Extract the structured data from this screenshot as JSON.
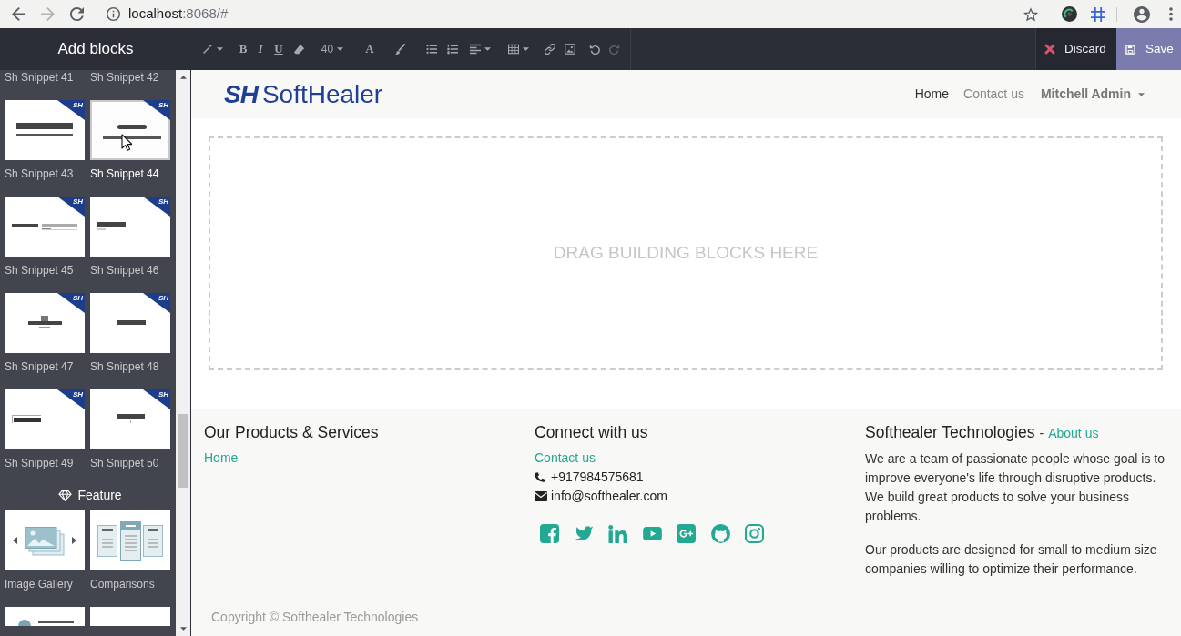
{
  "browser": {
    "nav_buttons": [
      {
        "kind": "back",
        "disabled": false
      },
      {
        "kind": "forward",
        "disabled": true
      },
      {
        "kind": "reload",
        "disabled": false
      }
    ],
    "url": {
      "host": "localhost",
      "path": ":8068/#"
    },
    "bookmarked": false
  },
  "editor_bar": {
    "sidebar_title": "Add blocks",
    "tools": [
      {
        "kind": "wand",
        "dropdown": true,
        "disabled": false
      },
      {
        "kind": "bold",
        "label": "B",
        "dropdown": false,
        "disabled": false
      },
      {
        "kind": "italic",
        "label": "I",
        "dropdown": false,
        "disabled": false
      },
      {
        "kind": "underline",
        "label": "U",
        "dropdown": false,
        "disabled": false
      },
      {
        "kind": "eraser",
        "dropdown": false,
        "disabled": false
      },
      {
        "kind": "fontsize",
        "label": "40",
        "dropdown": true,
        "disabled": false
      },
      {
        "kind": "fontcolor",
        "label": "A",
        "dropdown": false,
        "disabled": false
      },
      {
        "kind": "brush",
        "dropdown": false,
        "disabled": false
      },
      {
        "kind": "bullets",
        "dropdown": false,
        "disabled": false
      },
      {
        "kind": "numbers",
        "dropdown": false,
        "disabled": false
      },
      {
        "kind": "align",
        "dropdown": true,
        "disabled": false
      },
      {
        "kind": "table",
        "dropdown": true,
        "disabled": false
      },
      {
        "kind": "link",
        "dropdown": false,
        "disabled": false
      },
      {
        "kind": "image",
        "dropdown": false,
        "disabled": false
      },
      {
        "kind": "undo",
        "dropdown": false,
        "disabled": false
      },
      {
        "kind": "redo",
        "dropdown": false,
        "disabled": true
      }
    ],
    "discard": "Discard",
    "save": "Save"
  },
  "sidebar": {
    "sections": [
      {
        "items": [
          {
            "label": "Sh Snippet 41",
            "highlighted": false
          },
          {
            "label": "Sh Snippet 42",
            "highlighted": false
          },
          {
            "label": "Sh Snippet 43",
            "kind": "lines",
            "badge": "SH",
            "highlighted": false
          },
          {
            "label": "Sh Snippet 44",
            "kind": "pill",
            "badge": "SH",
            "highlighted": true
          },
          {
            "label": "Sh Snippet 45",
            "kind": "split",
            "badge": "SH",
            "highlighted": false
          },
          {
            "label": "Sh Snippet 46",
            "kind": "left",
            "badge": "SH",
            "highlighted": false
          },
          {
            "label": "Sh Snippet 47",
            "kind": "tee",
            "badge": "SH",
            "highlighted": false
          },
          {
            "label": "Sh Snippet 48",
            "kind": "bar",
            "badge": "SH",
            "highlighted": false
          },
          {
            "label": "Sh Snippet 49",
            "kind": "leftbar",
            "badge": "SH",
            "highlighted": false
          },
          {
            "label": "Sh Snippet 50",
            "kind": "centerbar",
            "badge": "SH",
            "highlighted": false
          }
        ]
      },
      {
        "title": "Feature",
        "items": [
          {
            "label": "Image Gallery",
            "kind": "gallery",
            "highlighted": false
          },
          {
            "label": "Comparisons",
            "kind": "compare",
            "highlighted": false
          },
          {
            "kind": "profile",
            "highlighted": false
          },
          {
            "kind": "blank",
            "highlighted": false
          }
        ]
      }
    ]
  },
  "site": {
    "header": {
      "logo": {
        "mark": "SH",
        "name": "SoftHealer"
      },
      "nav": [
        {
          "label": "Home",
          "selected": true
        },
        {
          "label": "Contact us",
          "selected": false
        }
      ],
      "user_menu": "Mitchell Admin"
    },
    "drop_zone": "DRAG BUILDING BLOCKS HERE",
    "footer": {
      "columns": [
        {
          "title": "Our Products & Services",
          "links": [
            "Home"
          ]
        },
        {
          "title": "Connect with us",
          "links": [
            "Contact us"
          ],
          "contacts": [
            {
              "kind": "phone",
              "text": "+917984575681"
            },
            {
              "kind": "email",
              "text": "info@softhealer.com"
            }
          ],
          "social": [
            {
              "kind": "facebook"
            },
            {
              "kind": "twitter"
            },
            {
              "kind": "linkedin"
            },
            {
              "kind": "youtube"
            },
            {
              "kind": "googleplus"
            },
            {
              "kind": "github"
            },
            {
              "kind": "instagram"
            }
          ]
        },
        {
          "title": "Softhealer Technologies",
          "separator": "-",
          "title_link": "About us",
          "paragraphs": [
            "We are a team of passionate people whose goal is to improve everyone's life through disruptive products. We build great products to solve your business problems.",
            "Our products are designed for small to medium size companies willing to optimize their performance."
          ]
        }
      ],
      "copyright": "Copyright © Softhealer Technologies"
    }
  }
}
